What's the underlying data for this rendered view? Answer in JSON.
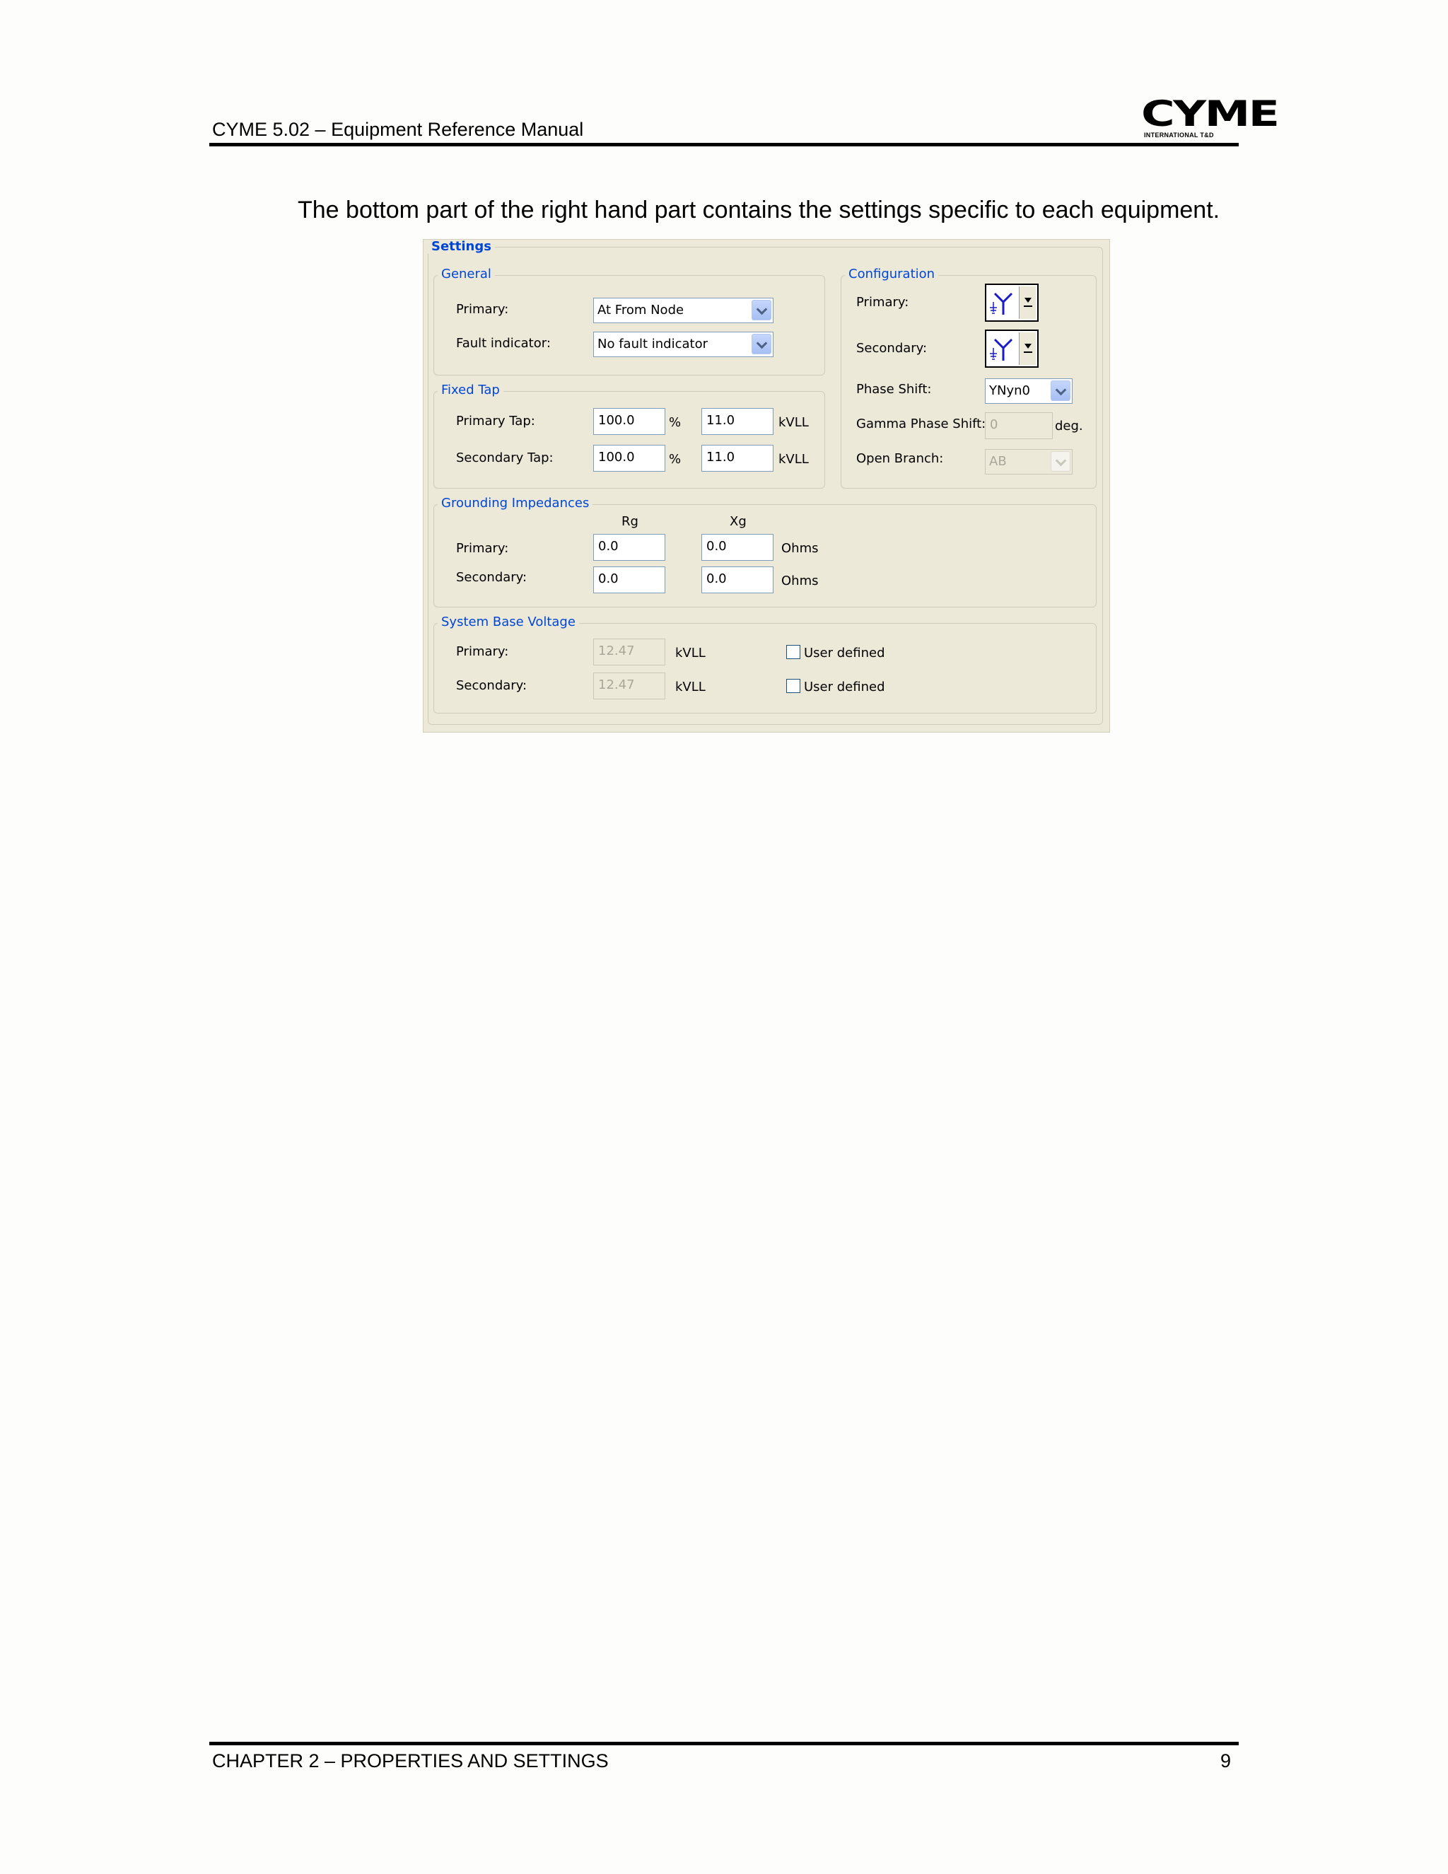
{
  "header": {
    "title": "CYME 5.02 – Equipment Reference Manual",
    "logo_text": "CYME",
    "logo_subtext": "INTERNATIONAL T&D"
  },
  "intro_text": "The bottom part of the right hand part contains the settings specific to each equipment.",
  "settings": {
    "title": "Settings",
    "general": {
      "title": "General",
      "primary_label": "Primary:",
      "primary_value": "At From Node",
      "fault_label": "Fault indicator:",
      "fault_value": "No fault indicator"
    },
    "fixed_tap": {
      "title": "Fixed Tap",
      "primary_label": "Primary Tap:",
      "primary_pct": "100.0",
      "primary_kv": "11.0",
      "secondary_label": "Secondary Tap:",
      "secondary_pct": "100.0",
      "secondary_kv": "11.0",
      "pct_unit": "%",
      "kv_unit": "kVLL"
    },
    "configuration": {
      "title": "Configuration",
      "primary_label": "Primary:",
      "secondary_label": "Secondary:",
      "primary_icon": "wye-grounded-icon",
      "secondary_icon": "wye-grounded-icon",
      "phase_shift_label": "Phase Shift:",
      "phase_shift_value": "YNyn0",
      "gamma_label": "Gamma Phase Shift:",
      "gamma_value": "0",
      "gamma_unit": "deg.",
      "open_branch_label": "Open Branch:",
      "open_branch_value": "AB"
    },
    "grounding": {
      "title": "Grounding Impedances",
      "rg_header": "Rg",
      "xg_header": "Xg",
      "primary_label": "Primary:",
      "primary_rg": "0.0",
      "primary_xg": "0.0",
      "secondary_label": "Secondary:",
      "secondary_rg": "0.0",
      "secondary_xg": "0.0",
      "unit": "Ohms"
    },
    "system_base": {
      "title": "System Base Voltage",
      "primary_label": "Primary:",
      "primary_value": "12.47",
      "secondary_label": "Secondary:",
      "secondary_value": "12.47",
      "unit": "kVLL",
      "user_defined_label": "User defined"
    }
  },
  "footer": {
    "chapter": "CHAPTER 2 – PROPERTIES AND SETTINGS",
    "page": "9"
  }
}
